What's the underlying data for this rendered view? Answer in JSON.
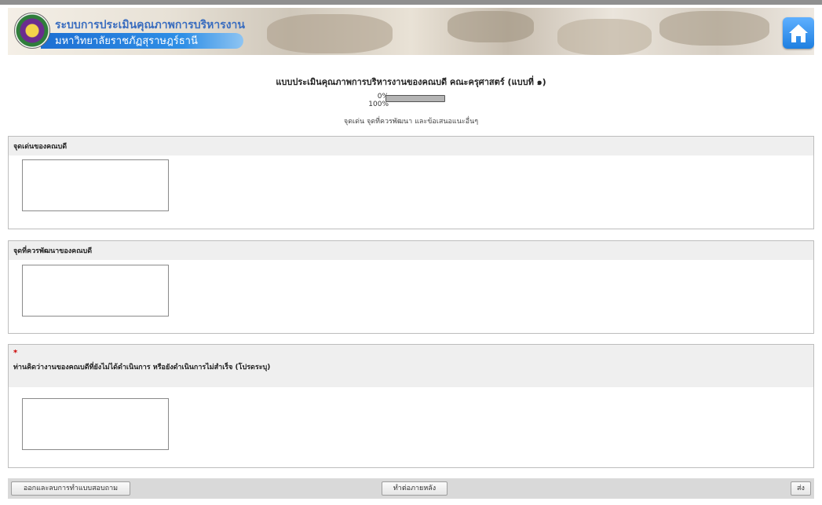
{
  "header": {
    "title_line1": "ระบบการประเมินคุณภาพการบริหารงาน",
    "title_line2": "มหาวิทยาลัยราชภัฏสุราษฎร์ธานี",
    "home_icon": "home-icon",
    "accent_color": "#2f8fe6"
  },
  "survey": {
    "title": "แบบประเมินคุณภาพการบริหารงานของคณบดี คณะครุศาสตร์ (แบบที่ ๑)",
    "progress": {
      "label_low": "0%",
      "label_high": "100%",
      "value_percent": 100
    },
    "section_caption": "จุดเด่น จุดที่ควรพัฒนา และข้อเสนอแนะอื่นๆ"
  },
  "questions": [
    {
      "label": "จุดเด่นของคณบดี",
      "required": false,
      "value": ""
    },
    {
      "label": "จุดที่ควรพัฒนาของคณบดี",
      "required": false,
      "value": ""
    },
    {
      "label": "ท่านคิดว่างานของคณบดีที่ยังไม่ได้ดำเนินการ หรือยังดำเนินการไม่สำเร็จ (โปรดระบุ)",
      "required": true,
      "required_mark": "*",
      "value": ""
    }
  ],
  "footer": {
    "exit_button": "ออกและลบการทำแบบสอบถาม",
    "later_button": "ทำต่อภายหลัง",
    "submit_button": "ส่ง"
  }
}
